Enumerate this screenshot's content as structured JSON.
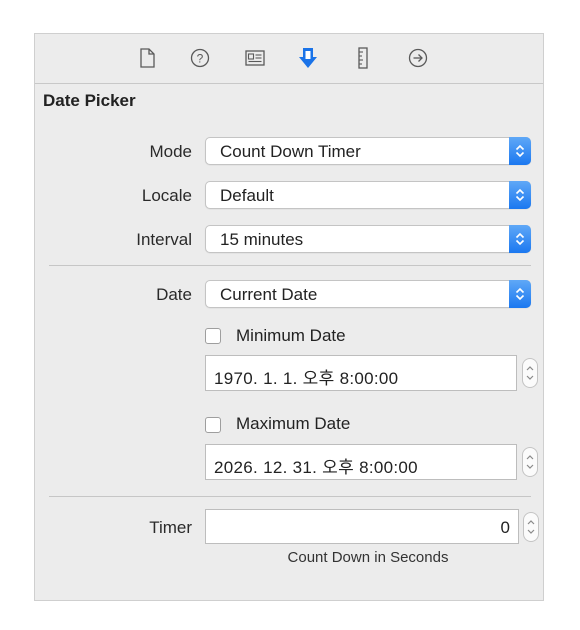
{
  "toolbar": {
    "icons": [
      "file-icon",
      "help-icon",
      "identity-icon",
      "attributes-icon",
      "size-icon",
      "connections-icon"
    ],
    "active_color": "#1a73e8"
  },
  "section": {
    "title": "Date Picker"
  },
  "mode": {
    "label": "Mode",
    "value": "Count Down Timer"
  },
  "locale": {
    "label": "Locale",
    "value": "Default"
  },
  "interval": {
    "label": "Interval",
    "value": "15 minutes"
  },
  "date": {
    "label": "Date",
    "value": "Current Date"
  },
  "minimum_date": {
    "label": "Minimum Date",
    "checked": false,
    "value": "1970.  1.   1. 오후  8:00:00"
  },
  "maximum_date": {
    "label": "Maximum Date",
    "checked": false,
    "value": "2026. 12.  31. 오후  8:00:00"
  },
  "timer": {
    "label": "Timer",
    "value": "0",
    "caption": "Count Down in Seconds"
  },
  "colors": {
    "accent": "#1b78f0",
    "panel_bg": "#ececec"
  }
}
